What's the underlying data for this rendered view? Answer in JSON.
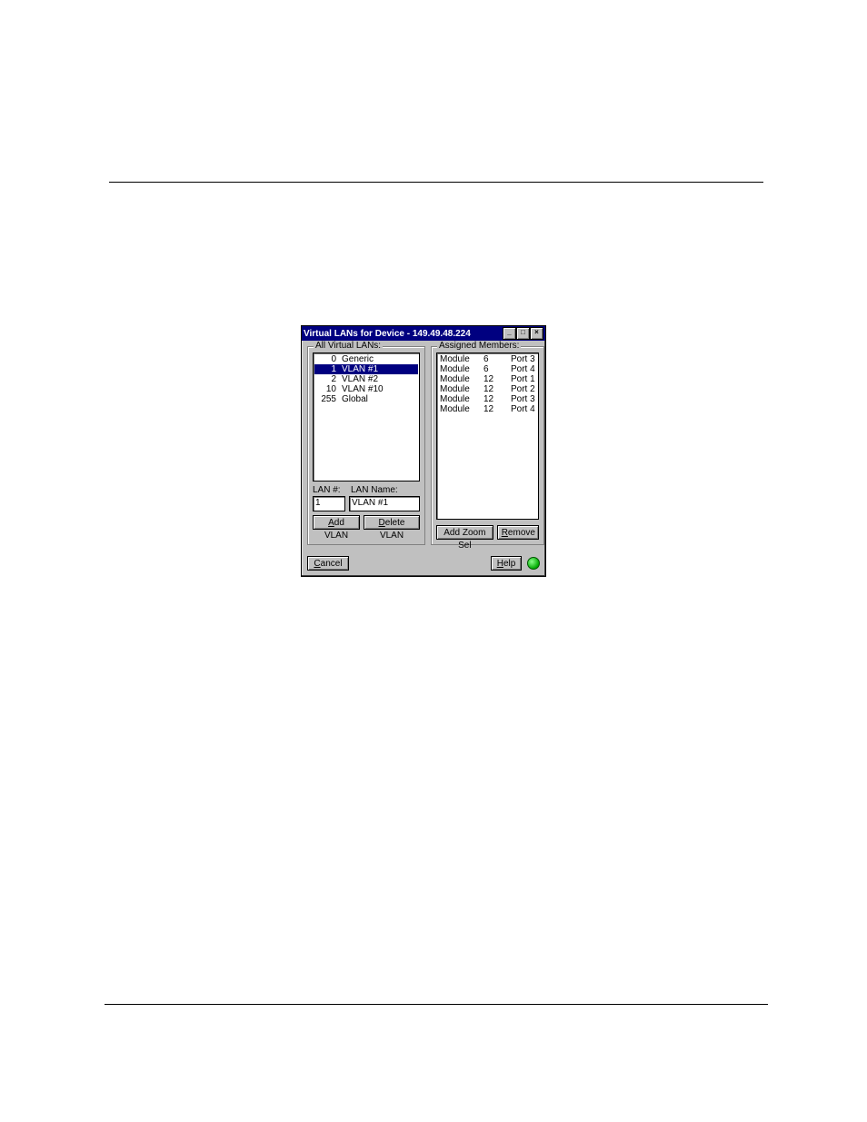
{
  "titlebar": {
    "text": "Virtual LANs for Device - 149.49.48.224"
  },
  "left_panel": {
    "label": "All Virtual LANs:",
    "items": [
      {
        "id": "0",
        "name": "Generic",
        "selected": false
      },
      {
        "id": "1",
        "name": "VLAN #1",
        "selected": true
      },
      {
        "id": "2",
        "name": "VLAN #2",
        "selected": false
      },
      {
        "id": "10",
        "name": "VLAN #10",
        "selected": false
      },
      {
        "id": "255",
        "name": "Global",
        "selected": false
      }
    ],
    "lan_num_label": "LAN #:",
    "lan_name_label": "LAN Name:",
    "lan_num_value": "1",
    "lan_name_value": "VLAN #1",
    "add_btn": "Add VLAN",
    "delete_btn": "Delete VLAN"
  },
  "right_panel": {
    "label": "Assigned Members:",
    "members": [
      {
        "mod": "Module",
        "num": "6",
        "port": "Port 3"
      },
      {
        "mod": "Module",
        "num": "6",
        "port": "Port 4"
      },
      {
        "mod": "Module",
        "num": "12",
        "port": "Port 1"
      },
      {
        "mod": "Module",
        "num": "12",
        "port": "Port 2"
      },
      {
        "mod": "Module",
        "num": "12",
        "port": "Port 3"
      },
      {
        "mod": "Module",
        "num": "12",
        "port": "Port 4"
      }
    ],
    "add_zoom_btn": "Add Zoom Sel",
    "remove_btn": "Remove"
  },
  "footer": {
    "cancel": "Cancel",
    "help": "Help"
  }
}
